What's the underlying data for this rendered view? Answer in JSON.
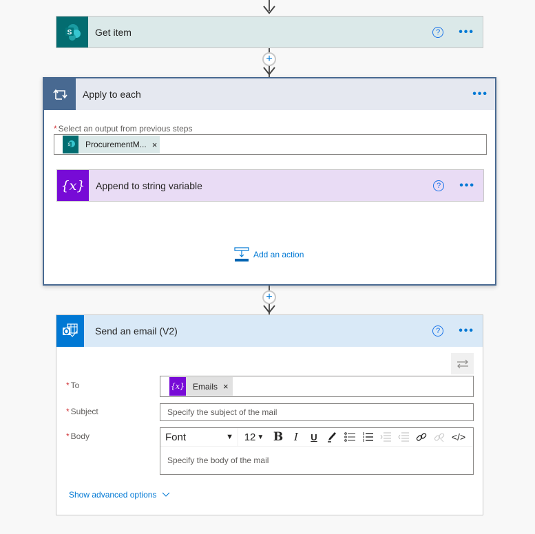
{
  "flow": {
    "get_item": {
      "title": "Get item",
      "icon": "sharepoint-icon",
      "help_glyph": "?",
      "more_glyph": "•••",
      "header_color": "#dbe9e9",
      "icon_color": "#036c70"
    },
    "apply_to_each": {
      "title": "Apply to each",
      "icon": "loop-icon",
      "more_glyph": "•••",
      "header_color": "#e5e8f0",
      "icon_color": "#486991",
      "select_label": "Select an output from previous steps",
      "required_mark": "*",
      "token": {
        "label": "ProcurementM...",
        "remove": "×",
        "icon": "sharepoint-icon"
      },
      "inner_action": {
        "title": "Append to string variable",
        "icon_text": "{x}",
        "help_glyph": "?",
        "more_glyph": "•••",
        "header_color": "#e9dcf5",
        "icon_color": "#770bd6"
      },
      "add_action_label": "Add an action"
    },
    "send_email": {
      "title": "Send an email (V2)",
      "icon": "outlook-icon",
      "help_glyph": "?",
      "more_glyph": "•••",
      "header_color": "#d9e9f7",
      "icon_color": "#0078d4",
      "swap_icon": "swap-arrows-icon",
      "fields": {
        "to": {
          "label": "To",
          "required_mark": "*",
          "token": {
            "label": "Emails",
            "icon_text": "{x}",
            "remove": "×"
          }
        },
        "subject": {
          "label": "Subject",
          "required_mark": "*",
          "placeholder": "Specify the subject of the mail"
        },
        "body": {
          "label": "Body",
          "required_mark": "*",
          "placeholder": "Specify the body of the mail",
          "toolbar": {
            "font": "Font",
            "size": "12",
            "dropdown_glyph": "▼",
            "bold": "B",
            "italic": "I",
            "underline": "U",
            "code": "</>"
          }
        }
      },
      "advanced_label": "Show advanced options"
    },
    "connector_plus": "+"
  }
}
